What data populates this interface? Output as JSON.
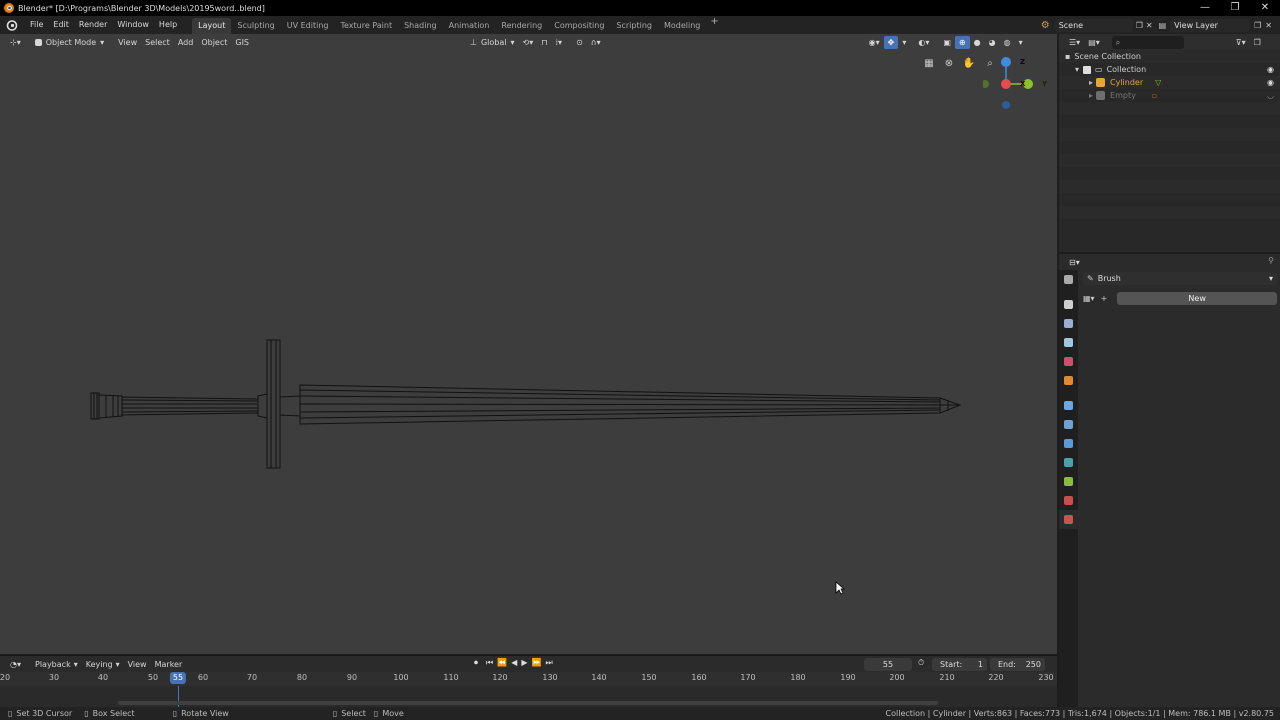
{
  "window": {
    "title": "Blender* [D:\\Programs\\Blender 3D\\Models\\20195word..blend]",
    "controls": [
      "—",
      "❐",
      "✕"
    ]
  },
  "menu": [
    "File",
    "Edit",
    "Render",
    "Window",
    "Help"
  ],
  "workspaces": [
    "Layout",
    "Sculpting",
    "UV Editing",
    "Texture Paint",
    "Shading",
    "Animation",
    "Rendering",
    "Compositing",
    "Scripting",
    "Modeling"
  ],
  "workspace_add": "+",
  "scene": {
    "name": "Scene",
    "view_layer": "View Layer"
  },
  "viewport": {
    "mode": "Object Mode",
    "menus": [
      "View",
      "Select",
      "Add",
      "Object",
      "GIS"
    ],
    "transform_orientation": "Global",
    "gizmo": {
      "z": "Z",
      "x": "X",
      "y": "Y"
    }
  },
  "outliner": {
    "scene_collection": "Scene Collection",
    "collection": "Collection",
    "objects": [
      {
        "name": "Cylinder",
        "color": "#e8a43b"
      },
      {
        "name": "Empty",
        "color": "#777777"
      }
    ]
  },
  "properties": {
    "brush_label": "Brush",
    "new_button": "New",
    "tab_colors": [
      "#aaaaaa",
      "#cfcfcf",
      "#9ab0d0",
      "#a2c6e0",
      "#c7526e",
      "#e08a35",
      "#6ea7e0",
      "#6fa1d1",
      "#5b9bd5",
      "#4aa3a6",
      "#8bb94b",
      "#c94f4f",
      "#cf5252"
    ]
  },
  "timeline": {
    "menus": [
      "Playback",
      "Keying",
      "View",
      "Marker"
    ],
    "current_frame": "55",
    "start_label": "Start:",
    "start": "1",
    "end_label": "End:",
    "end": "250",
    "ticks": [
      "20",
      "30",
      "40",
      "50",
      "60",
      "70",
      "80",
      "90",
      "100",
      "110",
      "120",
      "130",
      "140",
      "150",
      "160",
      "170",
      "180",
      "190",
      "200",
      "210",
      "220",
      "230"
    ],
    "playhead": "55"
  },
  "status": {
    "left": [
      {
        "label": "Set 3D Cursor"
      },
      {
        "label": "Box Select"
      },
      {
        "label": "Rotate View"
      },
      {
        "label": "Select"
      },
      {
        "label": "Move"
      }
    ],
    "right": "Collection | Cylinder | Verts:863 | Faces:773 | Tris:1,674 | Objects:1/1 | Mem: 786.1 MB | v2.80.75"
  },
  "colors": {
    "accent": "#4772b3",
    "viewport_bg": "#3d3d3d",
    "axis_x": "#e44c4c",
    "axis_y": "#8bc326",
    "axis_z": "#3f8be0"
  }
}
